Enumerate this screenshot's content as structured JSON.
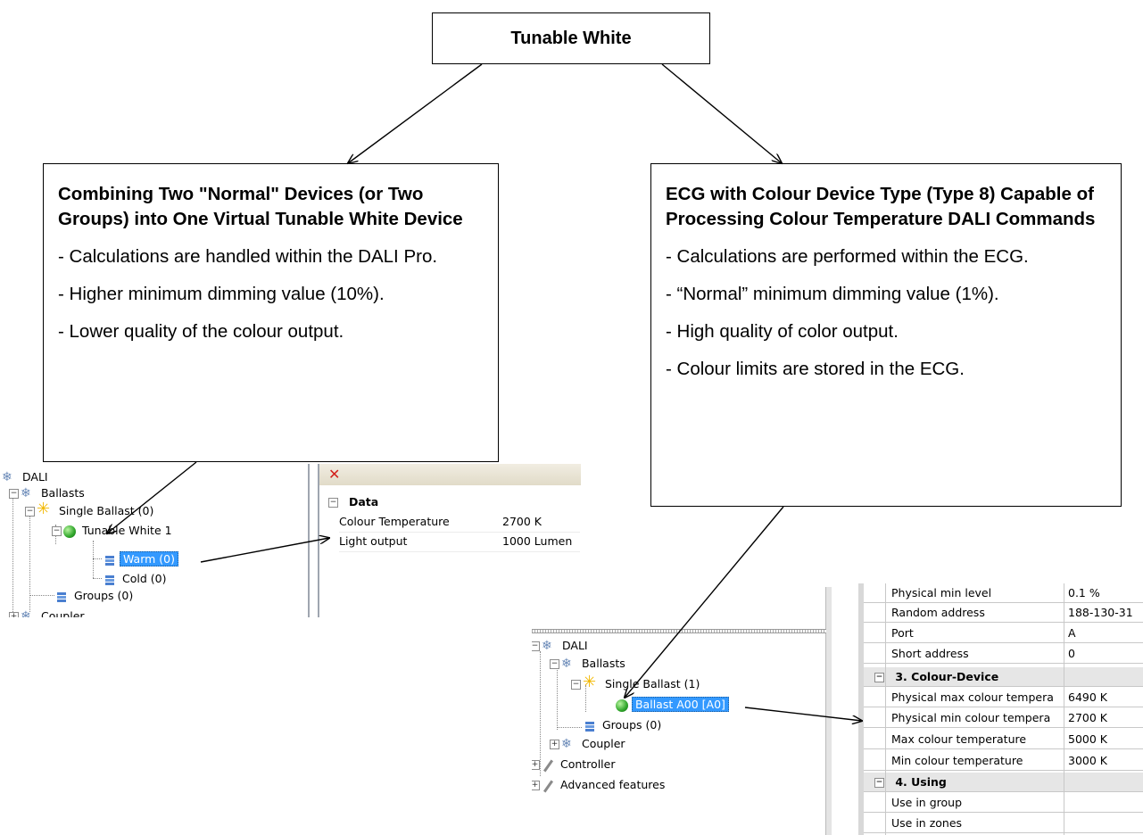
{
  "top": {
    "title": "Tunable White"
  },
  "left_option": {
    "title": "Combining Two \"Normal\" Devices (or Two Groups) into One Virtual Tunable White Device",
    "bullets": [
      "- Calculations are handled within the DALI Pro.",
      "- Higher minimum dimming value (10%).",
      "- Lower quality of the colour output."
    ]
  },
  "right_option": {
    "title": "ECG with Colour Device Type (Type 8) Capable of Processing Colour Temperature DALI Commands",
    "bullets": [
      "- Calculations are performed within the ECG.",
      "- “Normal” minimum dimming value (1%).",
      "- High quality of color output.",
      "- Colour limits are stored in the ECG."
    ]
  },
  "left_tree": {
    "root": "DALI",
    "ballasts": "Ballasts",
    "single_ballast": "Single Ballast (0)",
    "tunable": "Tunable White 1",
    "warm": "Warm (0)",
    "cold": "Cold (0)",
    "groups": "Groups (0)",
    "coupler_partial": "Coupler"
  },
  "left_props": {
    "close_glyph": "✕",
    "category": "Data",
    "rows": [
      {
        "name": "Colour Temperature",
        "value": "2700 K"
      },
      {
        "name": "Light output",
        "value": "1000 Lumen"
      }
    ]
  },
  "right_tree": {
    "root": "DALI",
    "ballasts": "Ballasts",
    "single_ballast": "Single Ballast (1)",
    "ballast": "Ballast A00 [A0]",
    "groups": "Groups (0)",
    "coupler": "Coupler",
    "controller": "Controller",
    "advanced": "Advanced features"
  },
  "right_props": {
    "rows_top": [
      {
        "name": "Physical min level",
        "value": "0.1 %"
      },
      {
        "name": "Random address",
        "value": "188-130-31"
      },
      {
        "name": "Port",
        "value": "A"
      },
      {
        "name": "Short address",
        "value": "0"
      }
    ],
    "cat3": "3. Colour-Device",
    "rows_colour": [
      {
        "name": "Physical max colour tempera",
        "value": "6490 K"
      },
      {
        "name": "Physical min colour tempera",
        "value": "2700 K"
      },
      {
        "name": "Max colour temperature",
        "value": "5000 K"
      },
      {
        "name": "Min colour temperature",
        "value": "3000 K"
      }
    ],
    "cat4": "4. Using",
    "rows_using": [
      {
        "name": "Use in group",
        "value": ""
      },
      {
        "name": "Use in zones",
        "value": ""
      }
    ]
  },
  "colors": {
    "selection": "#3399ff",
    "grid_line": "#c8c8c8",
    "category_bg": "#e6e6e6"
  },
  "icons": [
    "dali-icon",
    "ballast-sun-icon",
    "green-ball-icon",
    "group-icon",
    "controller-wand-icon",
    "close-icon",
    "collapse-icon"
  ]
}
